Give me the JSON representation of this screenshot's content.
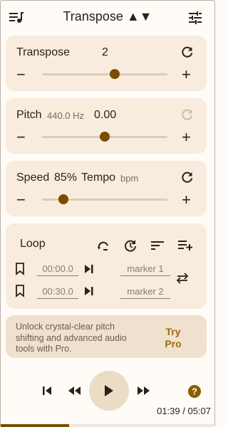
{
  "header": {
    "title": "Transpose ▲▼",
    "left_icon": "queue-music-icon",
    "right_icon": "tune-icon"
  },
  "transpose": {
    "label": "Transpose",
    "value": "2",
    "slider_fraction": 0.58,
    "minus": "−",
    "plus": "+"
  },
  "pitch": {
    "label": "Pitch",
    "hz": "440.0 Hz",
    "value": "0.00",
    "slider_fraction": 0.5,
    "minus": "−",
    "plus": "+",
    "reset_enabled": false
  },
  "speed": {
    "label": "Speed",
    "value": "85%",
    "tempo_label": "Tempo",
    "bpm_label": "bpm",
    "slider_fraction": 0.17,
    "minus": "−",
    "plus": "+"
  },
  "loop": {
    "label": "Loop",
    "start_time": "00:00.0",
    "end_time": "00:30.0",
    "marker1": "marker 1",
    "marker2": "marker 2"
  },
  "promo": {
    "text": "Unlock crystal-clear pitch shifting and advanced audio tools with Pro.",
    "button": "Try Pro"
  },
  "player": {
    "time": "01:39 / 05:07",
    "progress_fraction": 0.32
  },
  "colors": {
    "accent": "#7a4d00",
    "card": "#f8ecde",
    "background": "#fffbf6"
  }
}
